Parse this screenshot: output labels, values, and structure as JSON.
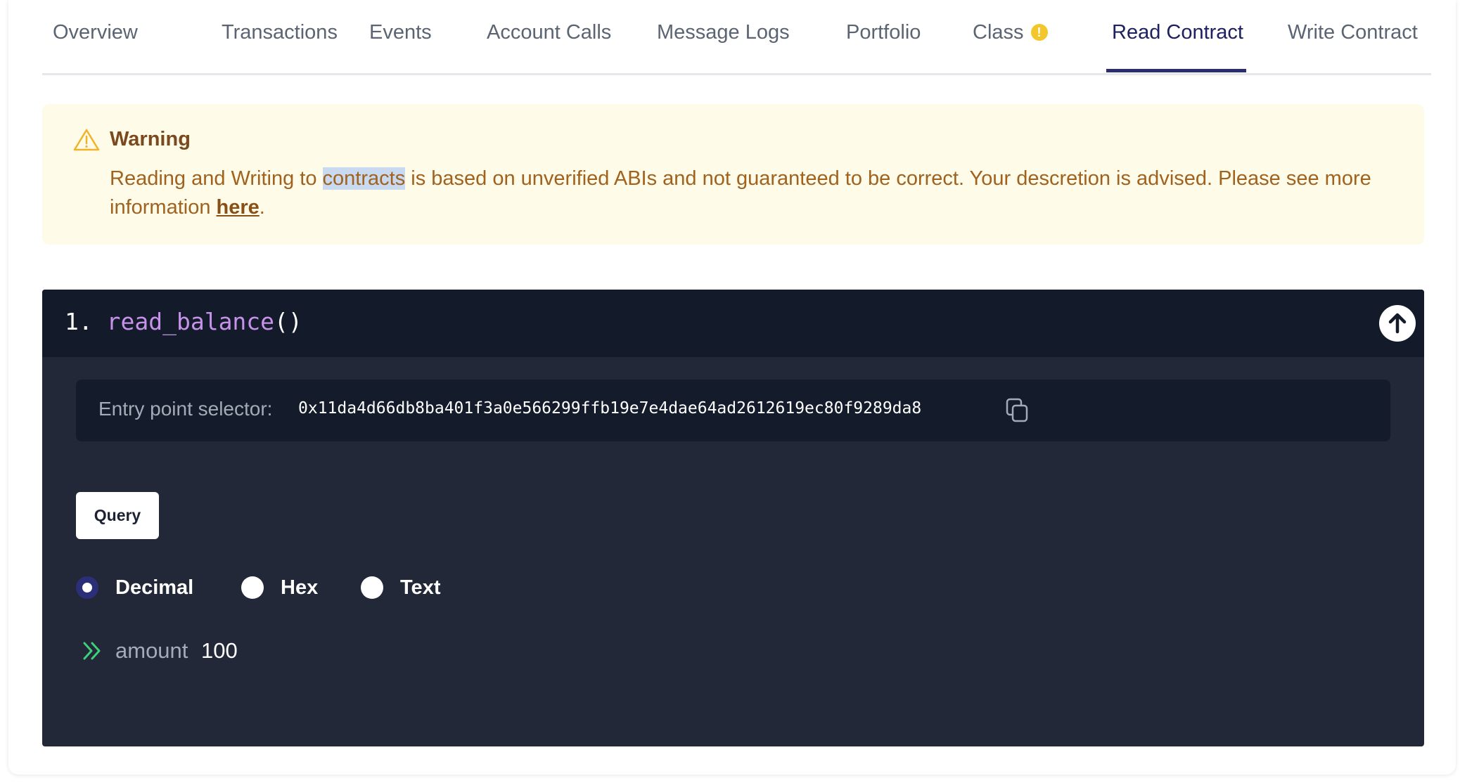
{
  "tabs": [
    {
      "label": "Overview"
    },
    {
      "label": "Transactions"
    },
    {
      "label": "Events"
    },
    {
      "label": "Account Calls"
    },
    {
      "label": "Message Logs"
    },
    {
      "label": "Portfolio"
    },
    {
      "label": "Class",
      "badge": "!"
    },
    {
      "label": "Read Contract",
      "active": true
    },
    {
      "label": "Write Contract"
    }
  ],
  "warning": {
    "title": "Warning",
    "text_before": "Reading and Writing to ",
    "highlighted_word": "contracts",
    "text_after": " is based on unverified ABIs and not guaranteed to be correct. Your descretion is advised. Please see more information ",
    "link_text": "here",
    "text_end": ".",
    "icon": "warning-triangle-icon"
  },
  "function": {
    "index": "1.",
    "name": "read_balance",
    "parens": "()",
    "collapse_icon": "arrow-up-icon",
    "selector_label": "Entry point selector:",
    "selector_value": "0x11da4d66db8ba401f3a0e566299ffb19e7e4dae64ad2612619ec80f9289da8",
    "copy_icon": "copy-icon",
    "query_label": "Query",
    "format_options": [
      {
        "label": "Decimal",
        "selected": true
      },
      {
        "label": "Hex",
        "selected": false
      },
      {
        "label": "Text",
        "selected": false
      }
    ],
    "result": {
      "icon": "double-chevron-right-icon",
      "name": "amount",
      "value": "100"
    }
  },
  "colors": {
    "active_tab": "#1e2160",
    "warning_bg": "#fefbe9",
    "warning_text": "#a0621f",
    "panel_bg": "#222837",
    "panel_header_bg": "#131a2a",
    "function_name": "#c792ea",
    "result_icon": "#3ecf7a",
    "badge": "#f3c62b"
  }
}
